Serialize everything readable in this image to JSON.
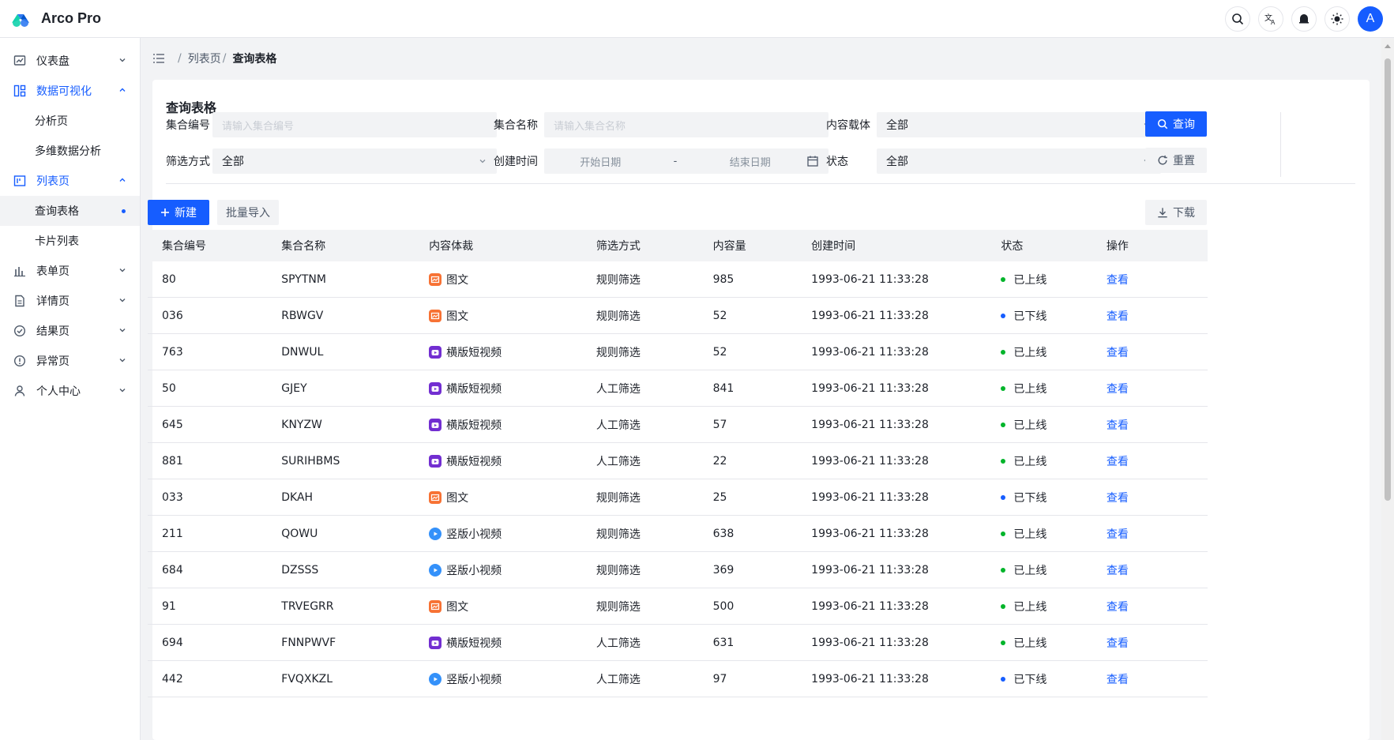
{
  "app": {
    "title": "Arco Pro"
  },
  "header": {
    "icons": [
      "search-icon",
      "translate-icon",
      "notification-icon",
      "theme-icon"
    ],
    "avatar_letter": "A"
  },
  "sidebar": {
    "items": [
      {
        "label": "仪表盘",
        "icon": "dashboard-icon",
        "expanded": false
      },
      {
        "label": "数据可视化",
        "icon": "visualization-icon",
        "expanded": true,
        "children": [
          {
            "label": "分析页"
          },
          {
            "label": "多维数据分析"
          }
        ]
      },
      {
        "label": "列表页",
        "icon": "list-icon",
        "expanded": true,
        "children": [
          {
            "label": "查询表格",
            "active": true
          },
          {
            "label": "卡片列表"
          }
        ]
      },
      {
        "label": "表单页",
        "icon": "form-icon",
        "expanded": false
      },
      {
        "label": "详情页",
        "icon": "detail-icon",
        "expanded": false
      },
      {
        "label": "结果页",
        "icon": "result-icon",
        "expanded": false
      },
      {
        "label": "异常页",
        "icon": "exception-icon",
        "expanded": false
      },
      {
        "label": "个人中心",
        "icon": "user-icon",
        "expanded": false
      }
    ]
  },
  "breadcrumb": {
    "items": [
      "列表页",
      "查询表格"
    ],
    "separator": "/"
  },
  "card": {
    "title": "查询表格",
    "filters": {
      "id_label": "集合编号",
      "id_placeholder": "请输入集合编号",
      "name_label": "集合名称",
      "name_placeholder": "请输入集合名称",
      "content_type_label": "内容载体",
      "content_type_value": "全部",
      "filter_type_label": "筛选方式",
      "filter_type_value": "全部",
      "created_label": "创建时间",
      "created_start": "开始日期",
      "created_sep": "-",
      "created_end": "结束日期",
      "status_label": "状态",
      "status_value": "全部"
    },
    "buttons": {
      "search": "查询",
      "reset": "重置",
      "create": "新建",
      "import": "批量导入",
      "download": "下载"
    }
  },
  "table": {
    "columns": [
      "集合编号",
      "集合名称",
      "内容体裁",
      "筛选方式",
      "内容量",
      "创建时间",
      "状态",
      "操作"
    ],
    "rows": [
      {
        "id": "80",
        "name": "SPYTNM",
        "type": "图文",
        "type_key": "image",
        "filter": "规则筛选",
        "count": "985",
        "created": "1993-06-21 11:33:28",
        "status": "已上线",
        "online": true,
        "action": "查看"
      },
      {
        "id": "036",
        "name": "RBWGV",
        "type": "图文",
        "type_key": "image",
        "filter": "规则筛选",
        "count": "52",
        "created": "1993-06-21 11:33:28",
        "status": "已下线",
        "online": false,
        "action": "查看"
      },
      {
        "id": "763",
        "name": "DNWUL",
        "type": "横版短视频",
        "type_key": "hvideo",
        "filter": "规则筛选",
        "count": "52",
        "created": "1993-06-21 11:33:28",
        "status": "已上线",
        "online": true,
        "action": "查看"
      },
      {
        "id": "50",
        "name": "GJEY",
        "type": "横版短视频",
        "type_key": "hvideo",
        "filter": "人工筛选",
        "count": "841",
        "created": "1993-06-21 11:33:28",
        "status": "已上线",
        "online": true,
        "action": "查看"
      },
      {
        "id": "645",
        "name": "KNYZW",
        "type": "横版短视频",
        "type_key": "hvideo",
        "filter": "人工筛选",
        "count": "57",
        "created": "1993-06-21 11:33:28",
        "status": "已上线",
        "online": true,
        "action": "查看"
      },
      {
        "id": "881",
        "name": "SURIHBMS",
        "type": "横版短视频",
        "type_key": "hvideo",
        "filter": "人工筛选",
        "count": "22",
        "created": "1993-06-21 11:33:28",
        "status": "已上线",
        "online": true,
        "action": "查看"
      },
      {
        "id": "033",
        "name": "DKAH",
        "type": "图文",
        "type_key": "image",
        "filter": "规则筛选",
        "count": "25",
        "created": "1993-06-21 11:33:28",
        "status": "已下线",
        "online": false,
        "action": "查看"
      },
      {
        "id": "211",
        "name": "QOWU",
        "type": "竖版小视频",
        "type_key": "vvideo",
        "filter": "规则筛选",
        "count": "638",
        "created": "1993-06-21 11:33:28",
        "status": "已上线",
        "online": true,
        "action": "查看"
      },
      {
        "id": "684",
        "name": "DZSSS",
        "type": "竖版小视频",
        "type_key": "vvideo",
        "filter": "规则筛选",
        "count": "369",
        "created": "1993-06-21 11:33:28",
        "status": "已上线",
        "online": true,
        "action": "查看"
      },
      {
        "id": "91",
        "name": "TRVEGRR",
        "type": "图文",
        "type_key": "image",
        "filter": "规则筛选",
        "count": "500",
        "created": "1993-06-21 11:33:28",
        "status": "已上线",
        "online": true,
        "action": "查看"
      },
      {
        "id": "694",
        "name": "FNNPWVF",
        "type": "横版短视频",
        "type_key": "hvideo",
        "filter": "人工筛选",
        "count": "631",
        "created": "1993-06-21 11:33:28",
        "status": "已上线",
        "online": true,
        "action": "查看"
      },
      {
        "id": "442",
        "name": "FVQXKZL",
        "type": "竖版小视频",
        "type_key": "vvideo",
        "filter": "人工筛选",
        "count": "97",
        "created": "1993-06-21 11:33:28",
        "status": "已下线",
        "online": false,
        "action": "查看"
      }
    ]
  },
  "colors": {
    "primary": "#165dff",
    "online": "#00b42a",
    "offline": "#165dff",
    "image": "#f77234",
    "hvideo": "#722ed1",
    "vvideo": "#3491fa"
  }
}
